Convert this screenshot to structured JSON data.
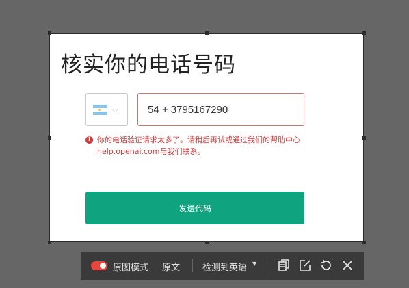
{
  "dialog": {
    "title": "核实你的电话号码",
    "country": {
      "flag": "argentina-flag-icon",
      "chevron": "chevron-down-icon"
    },
    "phone": {
      "value": "54 + 3795167290"
    },
    "error": {
      "icon": "error-circle-icon",
      "message": "你的电话验证请求太多了。请稍后再试或通过我们的帮助中心help.openai.com与我们联系。"
    },
    "send_button": "发送代码"
  },
  "toolbar": {
    "toggle_state": "on",
    "original_image_mode": "原图模式",
    "original_text": "原文",
    "detect_language": "检测到英语",
    "icons": [
      "copy-icon",
      "edit-icon",
      "refresh-icon",
      "close-icon"
    ]
  },
  "colors": {
    "background": "#666666",
    "accent": "#10a37f",
    "error": "#d23a3a",
    "toggle": "#e8453c",
    "toolbar_bg": "#3a3a3a"
  }
}
